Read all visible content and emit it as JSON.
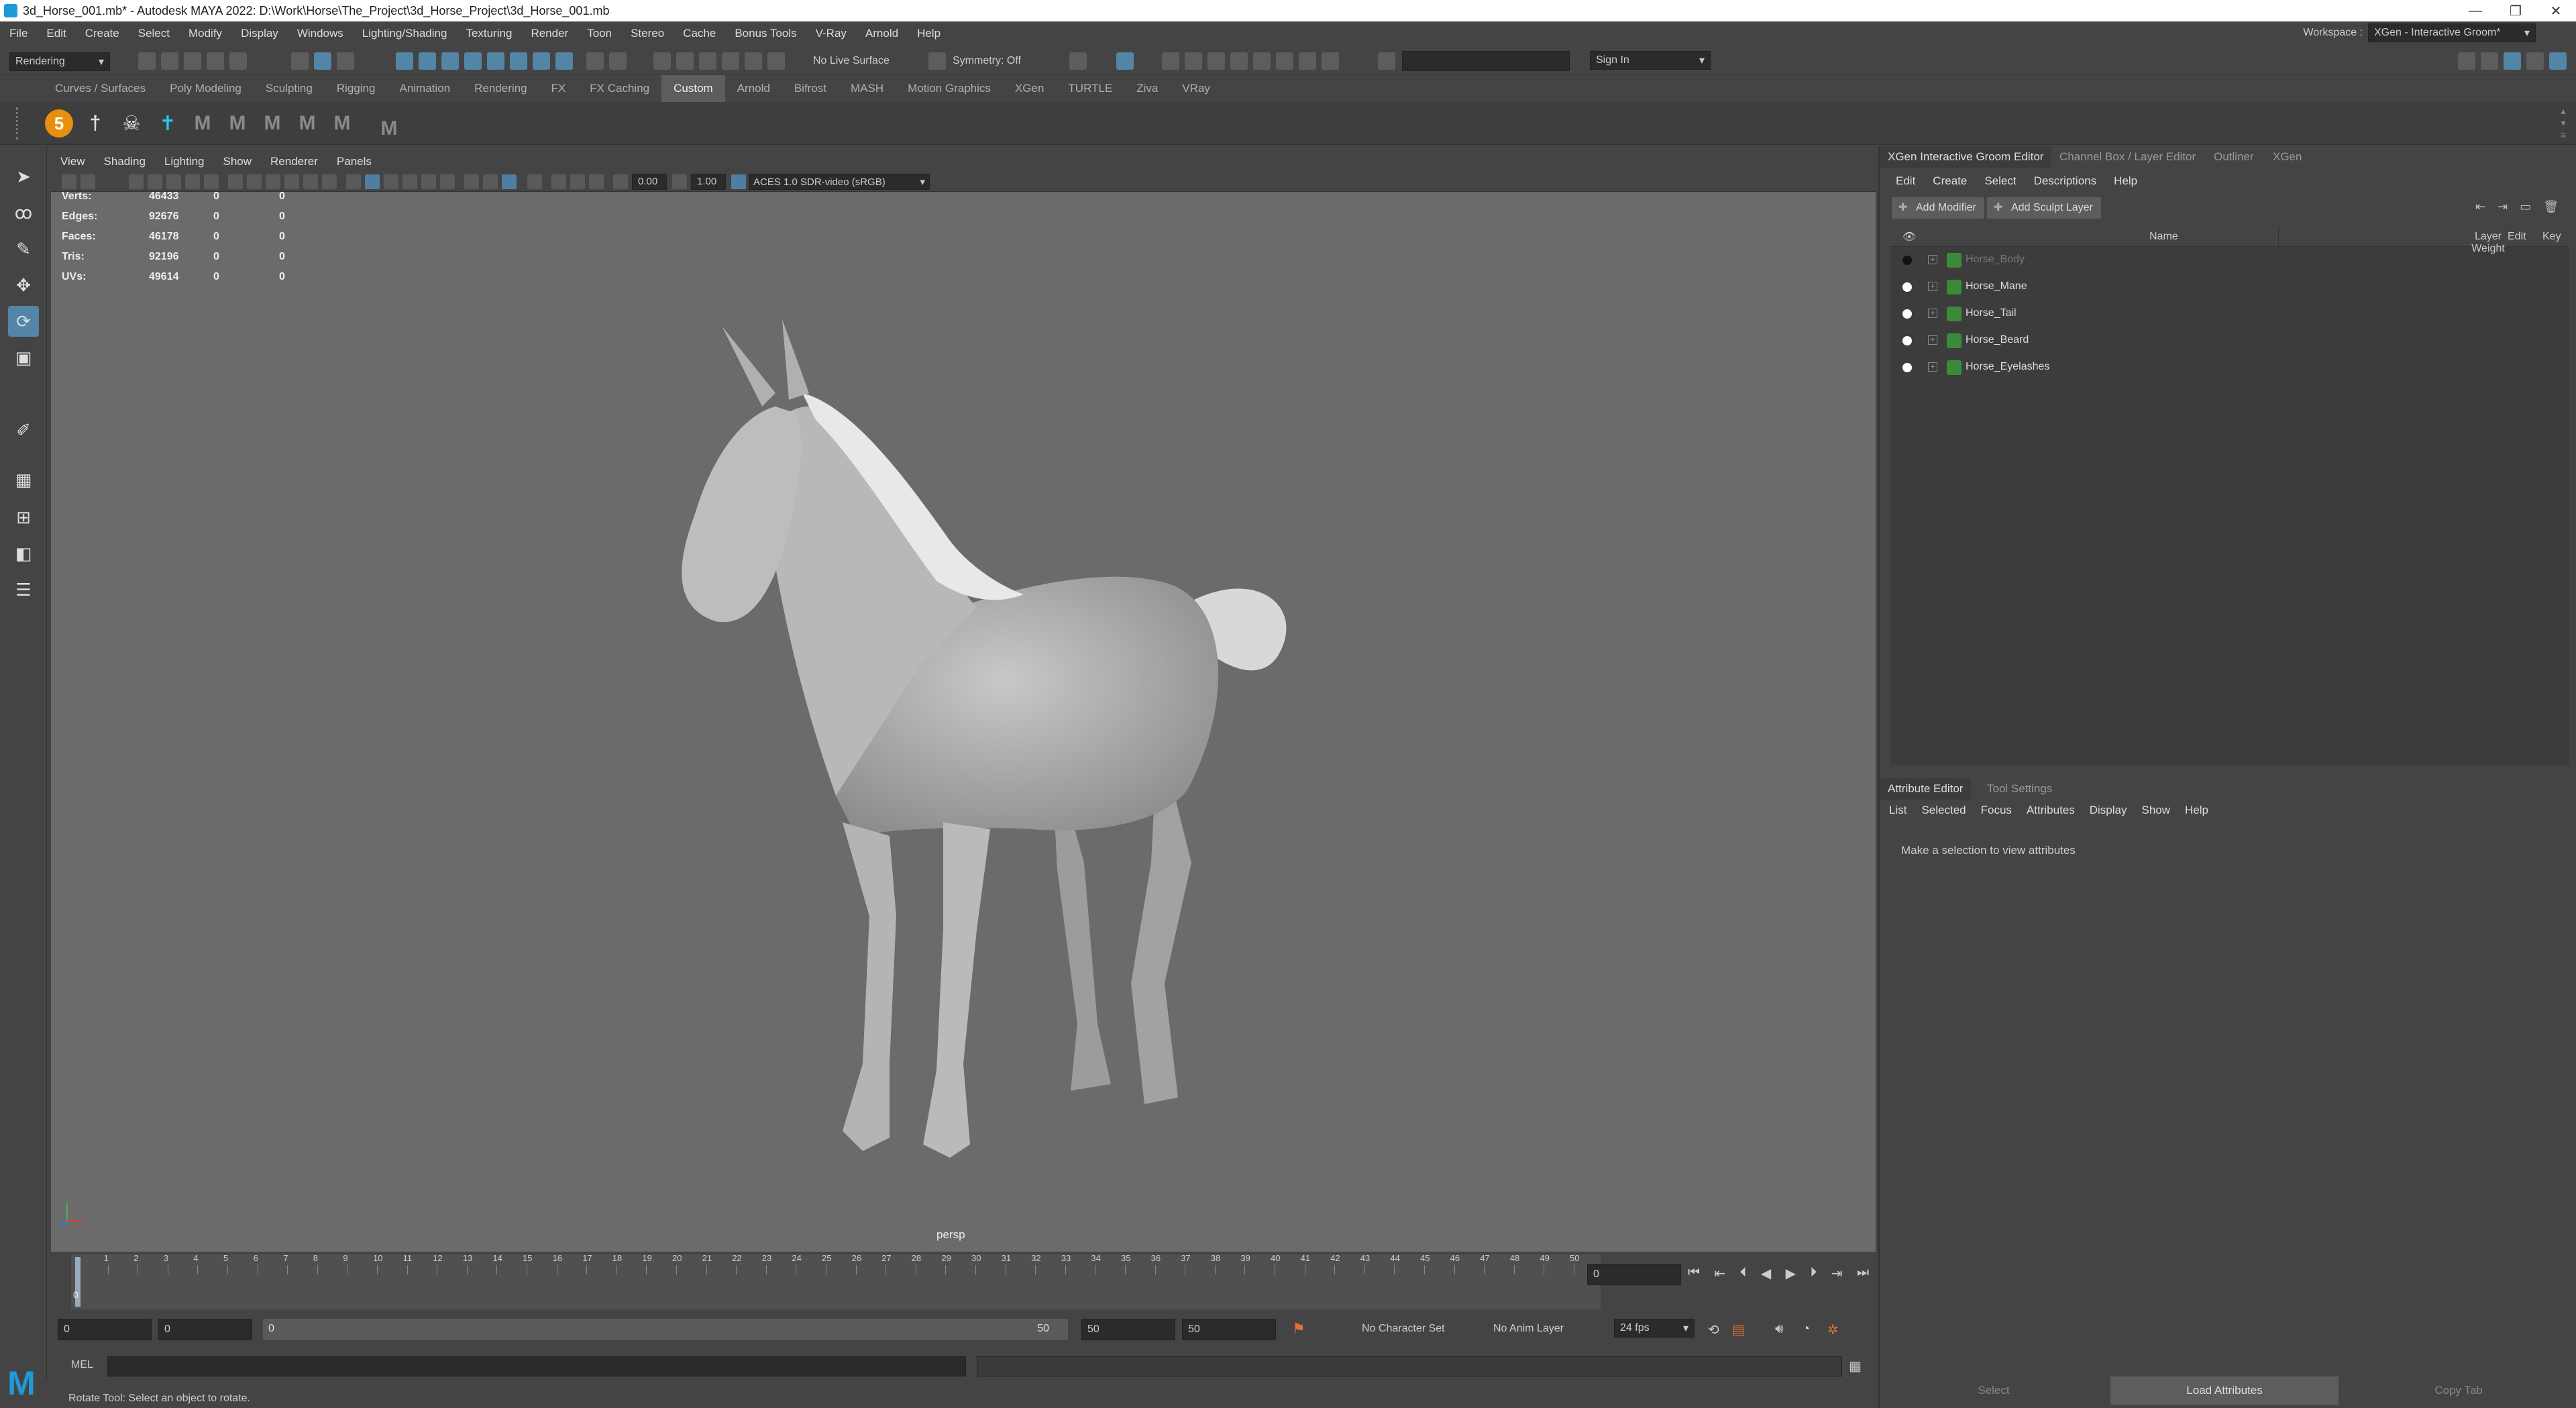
{
  "window": {
    "title": "3d_Horse_001.mb* - Autodesk MAYA 2022: D:\\Work\\Horse\\The_Project\\3d_Horse_Project\\3d_Horse_001.mb",
    "minimize": "—",
    "restore": "❐",
    "close": "✕"
  },
  "menu": [
    "File",
    "Edit",
    "Create",
    "Select",
    "Modify",
    "Display",
    "Windows",
    "Lighting/Shading",
    "Texturing",
    "Render",
    "Toon",
    "Stereo",
    "Cache",
    "Bonus Tools",
    "V-Ray",
    "Arnold",
    "Help"
  ],
  "workspace": {
    "label": "Workspace :",
    "value": "XGen - Interactive Groom*"
  },
  "statusline": {
    "menuset": "Rendering",
    "live_surface": "No Live Surface",
    "symmetry": "Symmetry: Off",
    "sign_in": "Sign In"
  },
  "shelf_tabs": [
    "Curves / Surfaces",
    "Poly Modeling",
    "Sculpting",
    "Rigging",
    "Animation",
    "Rendering",
    "FX",
    "FX Caching",
    "Custom",
    "Arnold",
    "Bifrost",
    "MASH",
    "Motion Graphics",
    "XGen",
    "TURTLE",
    "Ziva",
    "VRay"
  ],
  "shelf_active": "Custom",
  "viewport": {
    "menu": [
      "View",
      "Shading",
      "Lighting",
      "Show",
      "Renderer",
      "Panels"
    ],
    "exposure": "0.00",
    "gamma": "1.00",
    "colorspace": "ACES 1.0 SDR-video (sRGB)",
    "camera": "persp",
    "hud": [
      {
        "label": "Verts:",
        "v1": "46433",
        "v2": "0",
        "v3": "0"
      },
      {
        "label": "Edges:",
        "v1": "92676",
        "v2": "0",
        "v3": "0"
      },
      {
        "label": "Faces:",
        "v1": "46178",
        "v2": "0",
        "v3": "0"
      },
      {
        "label": "Tris:",
        "v1": "92196",
        "v2": "0",
        "v3": "0"
      },
      {
        "label": "UVs:",
        "v1": "49614",
        "v2": "0",
        "v3": "0"
      }
    ]
  },
  "timeline": {
    "ticks": [
      "0",
      "1",
      "2",
      "3",
      "4",
      "5",
      "6",
      "7",
      "8",
      "9",
      "10",
      "11",
      "12",
      "13",
      "14",
      "15",
      "16",
      "17",
      "18",
      "19",
      "20",
      "21",
      "22",
      "23",
      "24",
      "25",
      "26",
      "27",
      "28",
      "29",
      "30",
      "31",
      "32",
      "33",
      "34",
      "35",
      "36",
      "37",
      "38",
      "39",
      "40",
      "41",
      "42",
      "43",
      "44",
      "45",
      "46",
      "47",
      "48",
      "49",
      "50"
    ],
    "current_frame": "0",
    "current_marker": "0"
  },
  "range": {
    "start": "0",
    "playback_start": "0",
    "slider_start": "0",
    "slider_end": "50",
    "playback_end": "50",
    "end": "50",
    "character_set": "No Character Set",
    "anim_layer": "No Anim Layer",
    "fps": "24 fps"
  },
  "cmdline": {
    "lang": "MEL"
  },
  "helpline": "Rotate Tool: Select an object to rotate.",
  "right_panel": {
    "tabs": [
      "XGen Interactive Groom Editor",
      "Channel Box / Layer Editor",
      "Outliner",
      "XGen"
    ],
    "menu": [
      "Edit",
      "Create",
      "Select",
      "Descriptions",
      "Help"
    ],
    "add_modifier": "Add Modifier",
    "add_sculpt_layer": "Add Sculpt Layer",
    "columns": {
      "name": "Name",
      "weight": "Layer Weight",
      "edit": "Edit",
      "key": "Key"
    },
    "layers": [
      {
        "name": "Horse_Body",
        "dim": true
      },
      {
        "name": "Horse_Mane",
        "dim": false
      },
      {
        "name": "Horse_Tail",
        "dim": false
      },
      {
        "name": "Horse_Beard",
        "dim": false
      },
      {
        "name": "Horse_Eyelashes",
        "dim": false
      }
    ],
    "attr_tabs": [
      "Attribute Editor",
      "Tool Settings"
    ],
    "attr_menu": [
      "List",
      "Selected",
      "Focus",
      "Attributes",
      "Display",
      "Show",
      "Help"
    ],
    "attr_message": "Make a selection to view attributes",
    "bottom_buttons": [
      "Select",
      "Load Attributes",
      "Copy Tab"
    ]
  }
}
